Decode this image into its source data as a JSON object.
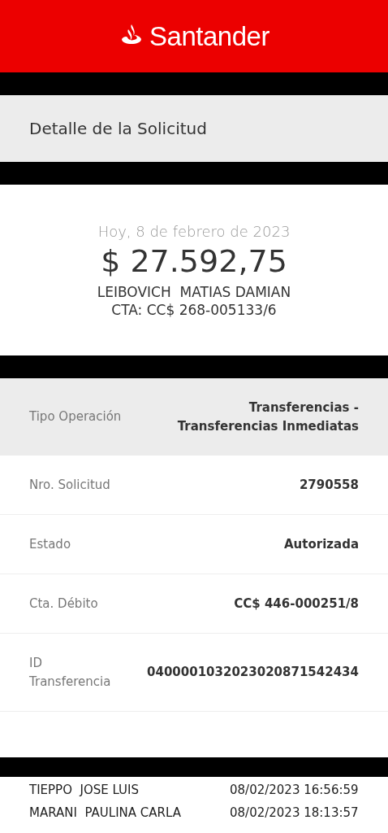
{
  "header": {
    "brand": "Santander"
  },
  "title": "Detalle de la Solicitud",
  "summary": {
    "date": "Hoy, 8 de febrero de 2023",
    "amount": "$ 27.592,75",
    "name": "LEIBOVICH  MATIAS DAMIAN",
    "account": "CTA: CC$ 268-005133/6"
  },
  "details": [
    {
      "label": "Tipo Operación",
      "value": "Transferencias -\nTransferencias Inmediatas",
      "highlighted": true
    },
    {
      "label": "Nro. Solicitud",
      "value": "2790558",
      "highlighted": false
    },
    {
      "label": "Estado",
      "value": "Autorizada",
      "highlighted": false
    },
    {
      "label": "Cta. Débito",
      "value": "CC$ 446-000251/8",
      "highlighted": false
    },
    {
      "label": "ID\nTransferencia",
      "value": "0400001032023020871542434",
      "highlighted": false
    }
  ],
  "signers": [
    {
      "name": "TIEPPO  JOSE LUIS",
      "time": "08/02/2023 16:56:59"
    },
    {
      "name": "MARANI  PAULINA CARLA",
      "time": "08/02/2023 18:13:57"
    }
  ]
}
